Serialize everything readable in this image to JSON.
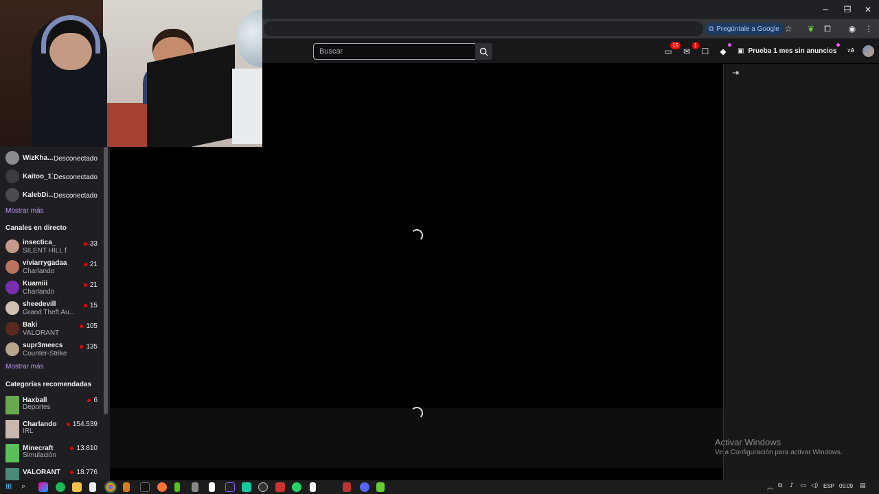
{
  "browser": {
    "google_pill": "Pregúntale a Google",
    "window_controls": {
      "minimize": "─",
      "restore": "❐",
      "close": "✕"
    }
  },
  "topbar": {
    "search_placeholder": "Buscar",
    "notifications_count": "15",
    "inbox_count": "1",
    "prime_label": "Prueba 1 mes sin anuncios"
  },
  "sidebar": {
    "followed": [
      {
        "name": "WizKha...",
        "status": "Desconectado",
        "color": "#8a8a8f"
      },
      {
        "name": "Kaitoo_17",
        "status": "Desconectado",
        "color": "#3b3b42"
      },
      {
        "name": "KalebDi...",
        "status": "Desconectado",
        "color": "#4a4a50"
      }
    ],
    "show_more": "Mostrar más",
    "live_heading": "Canales en directo",
    "live": [
      {
        "name": "insectica_",
        "game": "SILENT HILL f",
        "viewers": "33",
        "color": "#c49a8b"
      },
      {
        "name": "viviarrygadaa",
        "game": "Charlando",
        "viewers": "21",
        "color": "#b8755f"
      },
      {
        "name": "Kuamiii",
        "game": "Charlando",
        "viewers": "21",
        "color": "#7a2fb0"
      },
      {
        "name": "sheedevill",
        "game": "Grand Theft Au...",
        "viewers": "15",
        "color": "#d0c0b0"
      },
      {
        "name": "Baki",
        "game": "VALORANT",
        "viewers": "105",
        "color": "#5a2a1e"
      },
      {
        "name": "supr3meecs",
        "game": "Counter-Strike",
        "viewers": "135",
        "color": "#b8a68e"
      }
    ],
    "show_more_2": "Mostrar más",
    "cat_heading": "Categorías recomendadas",
    "categories": [
      {
        "name": "Haxball",
        "tag": "Deportes",
        "viewers": "6",
        "color": "#6aa84f"
      },
      {
        "name": "Charlando",
        "tag": "IRL",
        "viewers": "154.539",
        "color": "#c9b6b0"
      },
      {
        "name": "Minecraft",
        "tag": "Simulación",
        "viewers": "13.810",
        "color": "#5bbf5b"
      },
      {
        "name": "VALORANT",
        "tag": "",
        "viewers": "18.776",
        "color": "#4a8a7a"
      }
    ]
  },
  "chat": {
    "collapse_icon": "⇥"
  },
  "watermark": {
    "line1": "Activar Windows",
    "line2": "Ve a Configuración para activar Windows."
  },
  "taskbar": {
    "lang": "ESP",
    "time": "05:09"
  }
}
